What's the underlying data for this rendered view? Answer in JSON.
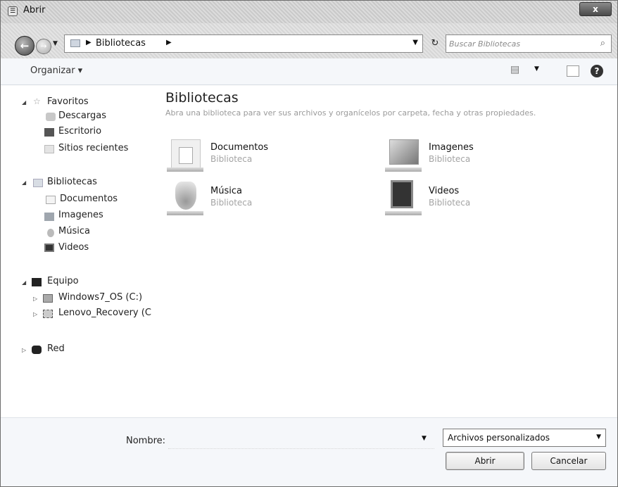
{
  "window": {
    "title": "Abrir",
    "close_label": "x"
  },
  "navigation": {
    "back_icon": "back-arrow-icon",
    "forward_icon": "forward-arrow-icon",
    "address": {
      "segment": "Bibliotecas"
    },
    "refresh_glyph": "↻",
    "search": {
      "placeholder": "Buscar Bibliotecas"
    }
  },
  "toolbar": {
    "organize_label": "Organizar ▾",
    "view_glyph": "▤",
    "help_glyph": "?"
  },
  "sidebar": {
    "favorites": {
      "label": "Favoritos",
      "items": [
        {
          "label": "Descargas",
          "icon": "downloads-icon"
        },
        {
          "label": "Escritorio",
          "icon": "desktop-icon"
        },
        {
          "label": "Sitios recientes",
          "icon": "recent-places-icon"
        }
      ]
    },
    "libraries": {
      "label": "Bibliotecas",
      "items": [
        {
          "label": "Documentos",
          "icon": "documents-icon"
        },
        {
          "label": "Imagenes",
          "icon": "pictures-icon"
        },
        {
          "label": "Música",
          "icon": "music-icon"
        },
        {
          "label": "Videos",
          "icon": "videos-icon"
        }
      ]
    },
    "computer": {
      "label": "Equipo",
      "items": [
        {
          "label": "Windows7_OS (C:)",
          "icon": "drive-icon"
        },
        {
          "label": "Lenovo_Recovery (C",
          "icon": "usb-drive-icon"
        }
      ]
    },
    "network": {
      "label": "Red",
      "icon": "network-icon"
    }
  },
  "main": {
    "title": "Bibliotecas",
    "subtitle": "Abra una biblioteca para ver sus archivos y organícelos por carpeta, fecha y otras propiedades.",
    "libraries": [
      {
        "name": "Documentos",
        "type": "Biblioteca",
        "icon": "documents-library-icon"
      },
      {
        "name": "Imagenes",
        "type": "Biblioteca",
        "icon": "pictures-library-icon"
      },
      {
        "name": "Música",
        "type": "Biblioteca",
        "icon": "music-library-icon"
      },
      {
        "name": "Videos",
        "type": "Biblioteca",
        "icon": "videos-library-icon"
      }
    ]
  },
  "footer": {
    "name_label": "Nombre:",
    "name_value": "",
    "filter": {
      "selected": "Archivos personalizados"
    },
    "open_label": "Abrir",
    "cancel_label": "Cancelar"
  }
}
